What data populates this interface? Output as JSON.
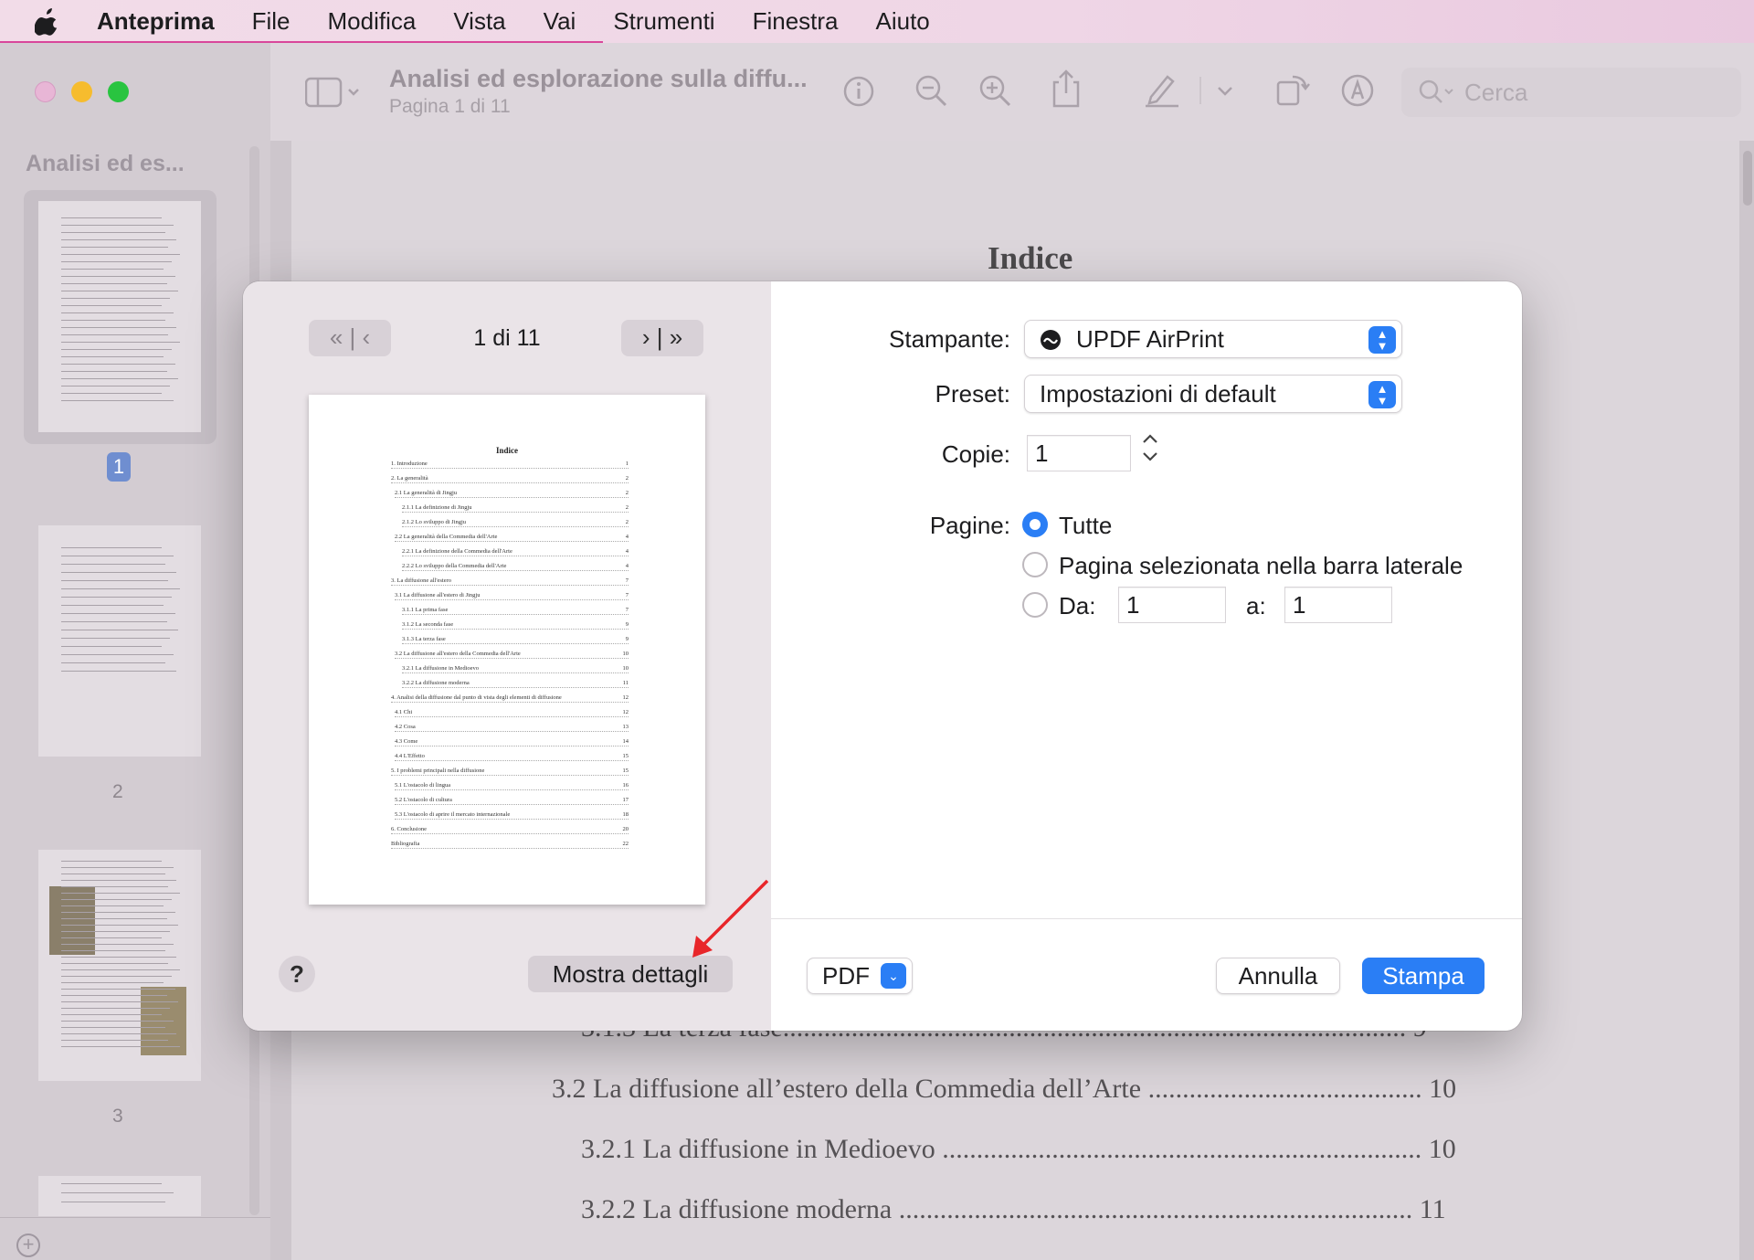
{
  "menubar": {
    "app": "Anteprima",
    "items": [
      "File",
      "Modifica",
      "Vista",
      "Vai",
      "Strumenti",
      "Finestra",
      "Aiuto"
    ]
  },
  "toolbar": {
    "title": "Analisi ed esplorazione sulla diffu...",
    "subtitle": "Pagina 1 di 11",
    "search_placeholder": "Cerca"
  },
  "sidebar": {
    "title": "Analisi ed es...",
    "page_numbers": [
      "1",
      "2",
      "3"
    ]
  },
  "document": {
    "heading": "Indice",
    "lines": [
      "3.1.3 La terza fase........................................................................................... 9",
      "3.2 La diffusione all’estero della Commedia dell’Arte ........................................ 10",
      "3.2.1 La diffusione in Medioevo ...................................................................... 10",
      "3.2.2 La diffusione moderna ........................................................................... 11"
    ]
  },
  "dialog": {
    "page_counter": "1 di 11",
    "preview": {
      "title": "Indice",
      "rows": [
        "1. Introduzione",
        "2. La generalità",
        "2.1 La generalità di Jingju",
        "2.1.1 La definizione di Jingju",
        "2.1.2 Lo sviluppo di Jingju",
        "2.2 La generalità della Commedia dell'Arte",
        "2.2.1 La definizione della Commedia dell'Arte",
        "2.2.2 Lo sviluppo della Commedia dell'Arte",
        "3. La diffusione all'estero",
        "3.1 La diffusione all'estero di Jingju",
        "3.1.1 La prima fase",
        "3.1.2 La seconda fase",
        "3.1.3 La terza fase",
        "3.2 La diffusione all'estero della Commedia dell'Arte",
        "3.2.1 La diffusione in Medioevo",
        "3.2.2 La diffusione moderna",
        "4. Analisi della diffusione dal punto di vista degli elementi di diffusione",
        "4.1 Chi",
        "4.2 Cosa",
        "4.3 Come",
        "4.4 L'Effetto",
        "5. I problemi principali nella diffusione",
        "5.1 L'ostacolo di lingua",
        "5.2 L'ostacolo di cultura",
        "5.3 L'ostacolo di aprire il mercato internazionale",
        "6. Conclusione",
        "Bibliografia"
      ],
      "page_refs": [
        "1",
        "2",
        "2",
        "2",
        "2",
        "4",
        "4",
        "4",
        "7",
        "7",
        "7",
        "9",
        "9",
        "10",
        "10",
        "11",
        "12",
        "12",
        "13",
        "14",
        "15",
        "15",
        "16",
        "17",
        "18",
        "20",
        "22"
      ]
    },
    "help_label": "?",
    "details_button": "Mostra dettagli",
    "printer_label": "Stampante:",
    "printer_value": "UPDF AirPrint",
    "preset_label": "Preset:",
    "preset_value": "Impostazioni di default",
    "copies_label": "Copie:",
    "copies_value": "1",
    "pages_label": "Pagine:",
    "option_all": "Tutte",
    "option_selected": "Pagina selezionata nella barra laterale",
    "from_label": "Da:",
    "from_value": "1",
    "to_label": "a:",
    "to_value": "1",
    "pdf_button": "PDF",
    "cancel_button": "Annulla",
    "print_button": "Stampa"
  },
  "colors": {
    "accent": "#2a7ef5",
    "annotation_arrow": "#e8262a"
  }
}
